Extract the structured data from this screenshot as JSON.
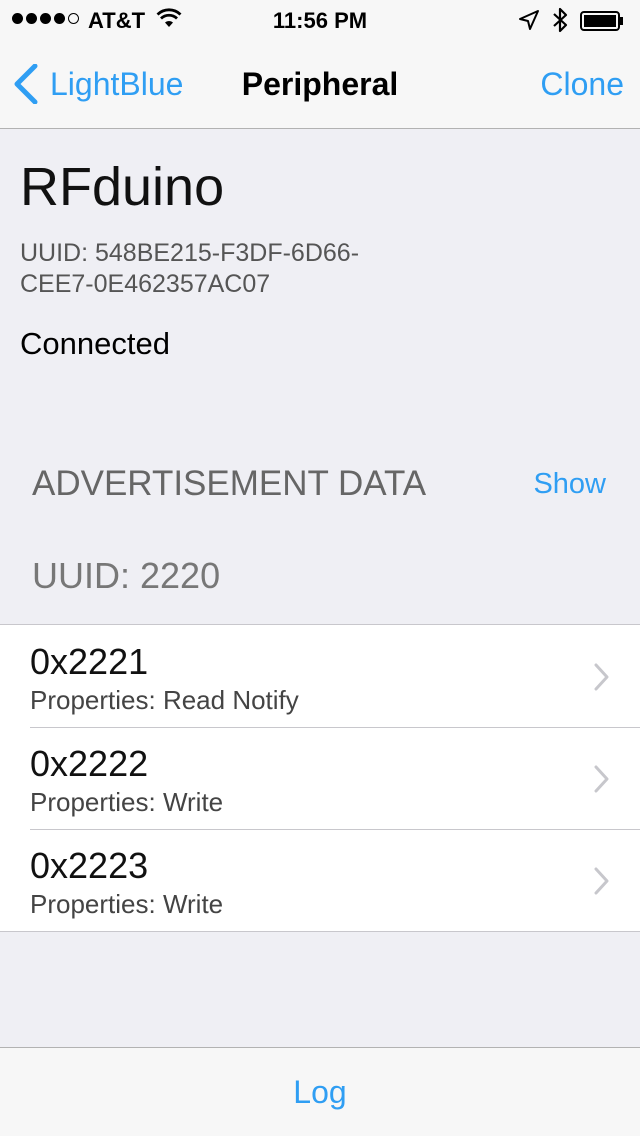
{
  "status_bar": {
    "carrier": "AT&T",
    "time": "11:56 PM",
    "signal_bars_filled": 4,
    "signal_bars_total": 5
  },
  "nav": {
    "back_label": "LightBlue",
    "title": "Peripheral",
    "action_label": "Clone"
  },
  "device": {
    "name": "RFduino",
    "uuid_line1": "UUID: 548BE215-F3DF-6D66-",
    "uuid_line2": "CEE7-0E462357AC07",
    "status": "Connected"
  },
  "advertisement": {
    "header": "ADVERTISEMENT DATA",
    "show_label": "Show"
  },
  "service": {
    "uuid_label": "UUID: 2220"
  },
  "characteristics": [
    {
      "title": "0x2221",
      "properties": "Properties: Read Notify"
    },
    {
      "title": "0x2222",
      "properties": "Properties: Write"
    },
    {
      "title": "0x2223",
      "properties": "Properties: Write"
    }
  ],
  "toolbar": {
    "log_label": "Log"
  },
  "colors": {
    "accent": "#2f9ef3",
    "background": "#efeff4"
  }
}
